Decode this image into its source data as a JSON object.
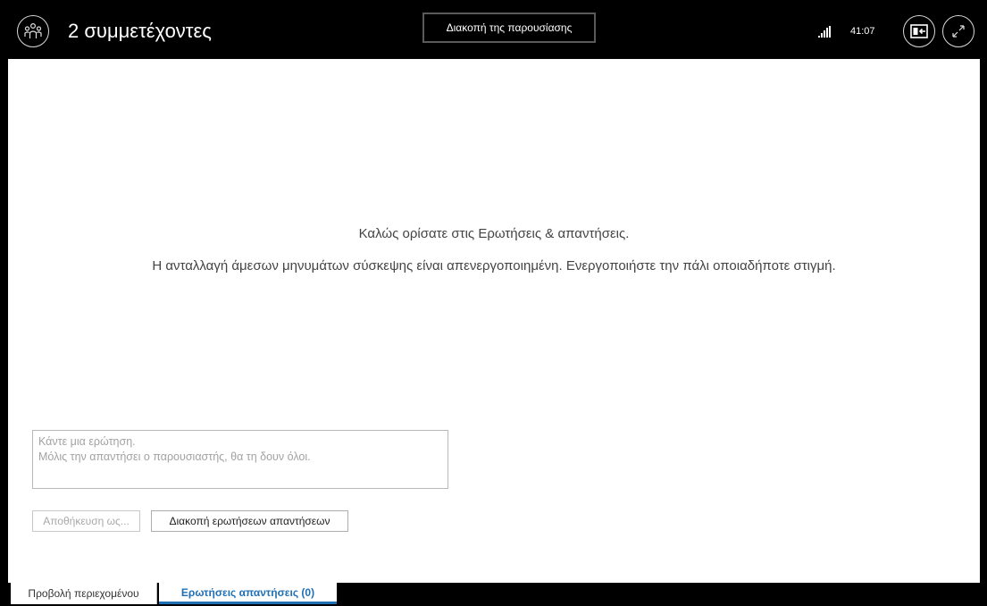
{
  "header": {
    "participants_title": "2 συμμετέχοντες",
    "stop_presenting_label": "Διακοπή της παρουσίασης",
    "timer": "41:07",
    "icons": {
      "participants": "participants-icon",
      "signal": "signal-strength-icon",
      "layout": "layout-toggle-icon",
      "fullscreen": "fullscreen-icon"
    }
  },
  "main": {
    "welcome_text": "Καλώς ορίσατε στις Ερωτήσεις & απαντήσεις.",
    "notice_text": "Η ανταλλαγή άμεσων μηνυμάτων σύσκεψης είναι απενεργοποιημένη. Ενεργοποιήστε την πάλι οποιαδήποτε στιγμή.",
    "question_input": {
      "placeholder_line1": "Κάντε μια ερώτηση.",
      "placeholder_line2": "Μόλις την απαντήσει ο παρουσιαστής, θα τη δουν όλοι."
    },
    "save_as_label": "Αποθήκευση ως...",
    "stop_qa_label": "Διακοπή ερωτήσεων  απαντήσεων"
  },
  "tabs": [
    {
      "label": "Προβολή περιεχομένου",
      "active": false
    },
    {
      "label": "Ερωτήσεις  απαντήσεις  (0)",
      "active": true
    }
  ],
  "colors": {
    "accent": "#1f6fb5",
    "header_bg": "#000000",
    "content_bg": "#ffffff"
  }
}
